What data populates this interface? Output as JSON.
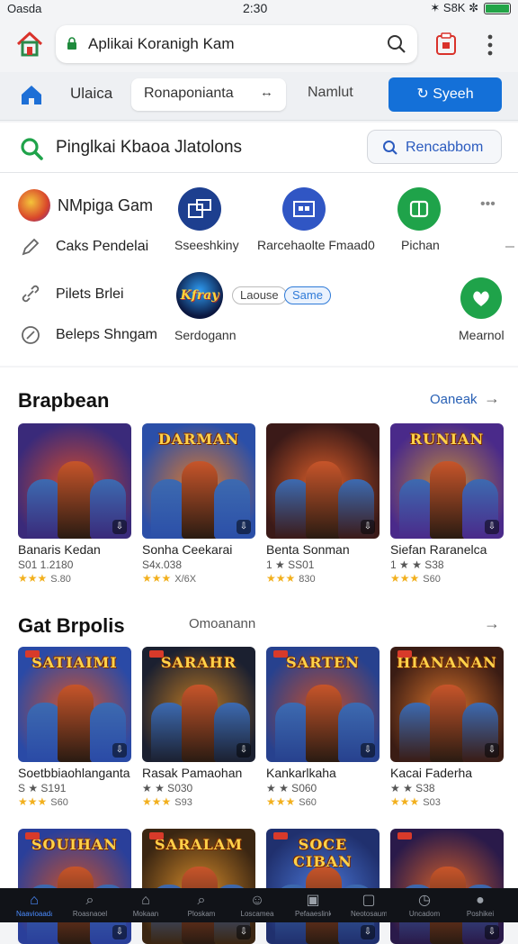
{
  "status_bar": {
    "left": "Oasda",
    "time": "2:30",
    "right": "✶ S8K ✼"
  },
  "browser": {
    "url_text": "Aplikai Koranigh Kam",
    "nav_label": "Ulaica",
    "nav_input_value": "Ronaponianta",
    "nav_input_arrow": "↔",
    "nav_label2": "Namlut",
    "primary_button": "Syeeh"
  },
  "panel": {
    "title": "Pinglkai Kbaoa Jlatolons",
    "search_button": "Rencabbom",
    "left_items": [
      "NMpiga Gam",
      "Caks Pendelai",
      "Pilets Brlei",
      "Beleps Shngam"
    ],
    "top_apps": [
      {
        "caption": "Sseeshkiny",
        "color": "#1d3f8f"
      },
      {
        "caption": "Rarcehaolte Fmaad0",
        "color": "#3056c4"
      },
      {
        "caption": "Pichan",
        "color": "#1fa34a"
      }
    ],
    "more_label": "•••",
    "mid_app": {
      "logo_text": "Kfray",
      "caption": "Serdogann",
      "pill1": "Laouse",
      "pill2": "Same"
    },
    "right_app": {
      "caption": "Mearnol",
      "color": "#1fa34a"
    }
  },
  "section1": {
    "title": "Brapbean",
    "link": "Oaneak",
    "arrow": "→",
    "cards": [
      {
        "name": "Banaris Kedan",
        "meta": "S01 1.2180",
        "rating": "★★★",
        "score": "S.80",
        "logo": "",
        "bg1": "#3a2a7a",
        "bg2": "#d44b2b"
      },
      {
        "name": "Sonha Ceekarai",
        "meta": "S4x.038",
        "rating": "★★★",
        "score": "X/6X",
        "logo": "DARMAN",
        "bg1": "#2b4fa8",
        "bg2": "#e0792a"
      },
      {
        "name": "Benta Sonman",
        "meta": "1 ★ SS01",
        "rating": "★★★",
        "score": "830",
        "logo": "",
        "bg1": "#3b1a18",
        "bg2": "#e0602a"
      },
      {
        "name": "Siefan Raranelca",
        "meta": "1 ★ ★ S38",
        "rating": "★★★",
        "score": "S60",
        "logo": "RUNIAN",
        "bg1": "#4a2a8a",
        "bg2": "#c48a3a"
      }
    ]
  },
  "section2": {
    "title": "Gat Brpolis",
    "link": "Omoanann",
    "arrow": "→",
    "cards": [
      {
        "name": "Soetbbiaohlanganta",
        "meta": "S ★ S191",
        "rating": "★★★",
        "score": "S60",
        "logo": "SATIAIMI",
        "bg1": "#2a4aa6",
        "bg2": "#d6532a"
      },
      {
        "name": "Rasak Pamaohan",
        "meta": "★ ★ S030",
        "rating": "★★★",
        "score": "S93",
        "logo": "SARAHR",
        "bg1": "#1b2030",
        "bg2": "#c07a22"
      },
      {
        "name": "Kankarlkaha",
        "meta": "★ ★ S060",
        "rating": "★★★",
        "score": "S60",
        "logo": "SARTEN",
        "bg1": "#27418e",
        "bg2": "#c44d2a"
      },
      {
        "name": "Kacai Faderha",
        "meta": "★ ★ S38",
        "rating": "★★★",
        "score": "S03",
        "logo": "HIANANAN",
        "bg1": "#3a1c14",
        "bg2": "#d9722a"
      }
    ]
  },
  "section3": {
    "cards": [
      {
        "logo": "SOUIHAN",
        "bg1": "#2a3f9a",
        "bg2": "#c9502a"
      },
      {
        "logo": "SARALAM",
        "bg1": "#3b2612",
        "bg2": "#d48a2a"
      },
      {
        "logo": "SOCE CIBAN",
        "bg1": "#20306e",
        "bg2": "#4a76d6"
      },
      {
        "logo": "",
        "bg1": "#2a1a4a",
        "bg2": "#d4602a"
      }
    ]
  },
  "bottom_nav": [
    {
      "label": "Naavioaadab",
      "icon": "home-icon"
    },
    {
      "label": "Roasnaoel",
      "icon": "search-icon"
    },
    {
      "label": "Mokaan",
      "icon": "house-icon"
    },
    {
      "label": "Ploskam",
      "icon": "search-icon"
    },
    {
      "label": "Loscamea",
      "icon": "smile-icon"
    },
    {
      "label": "Pefaaeslinkt",
      "icon": "gallery-icon"
    },
    {
      "label": "Neotosaum",
      "icon": "box-icon"
    },
    {
      "label": "Uncadom",
      "icon": "clock-icon"
    },
    {
      "label": "Poshikei",
      "icon": "user-icon"
    }
  ]
}
